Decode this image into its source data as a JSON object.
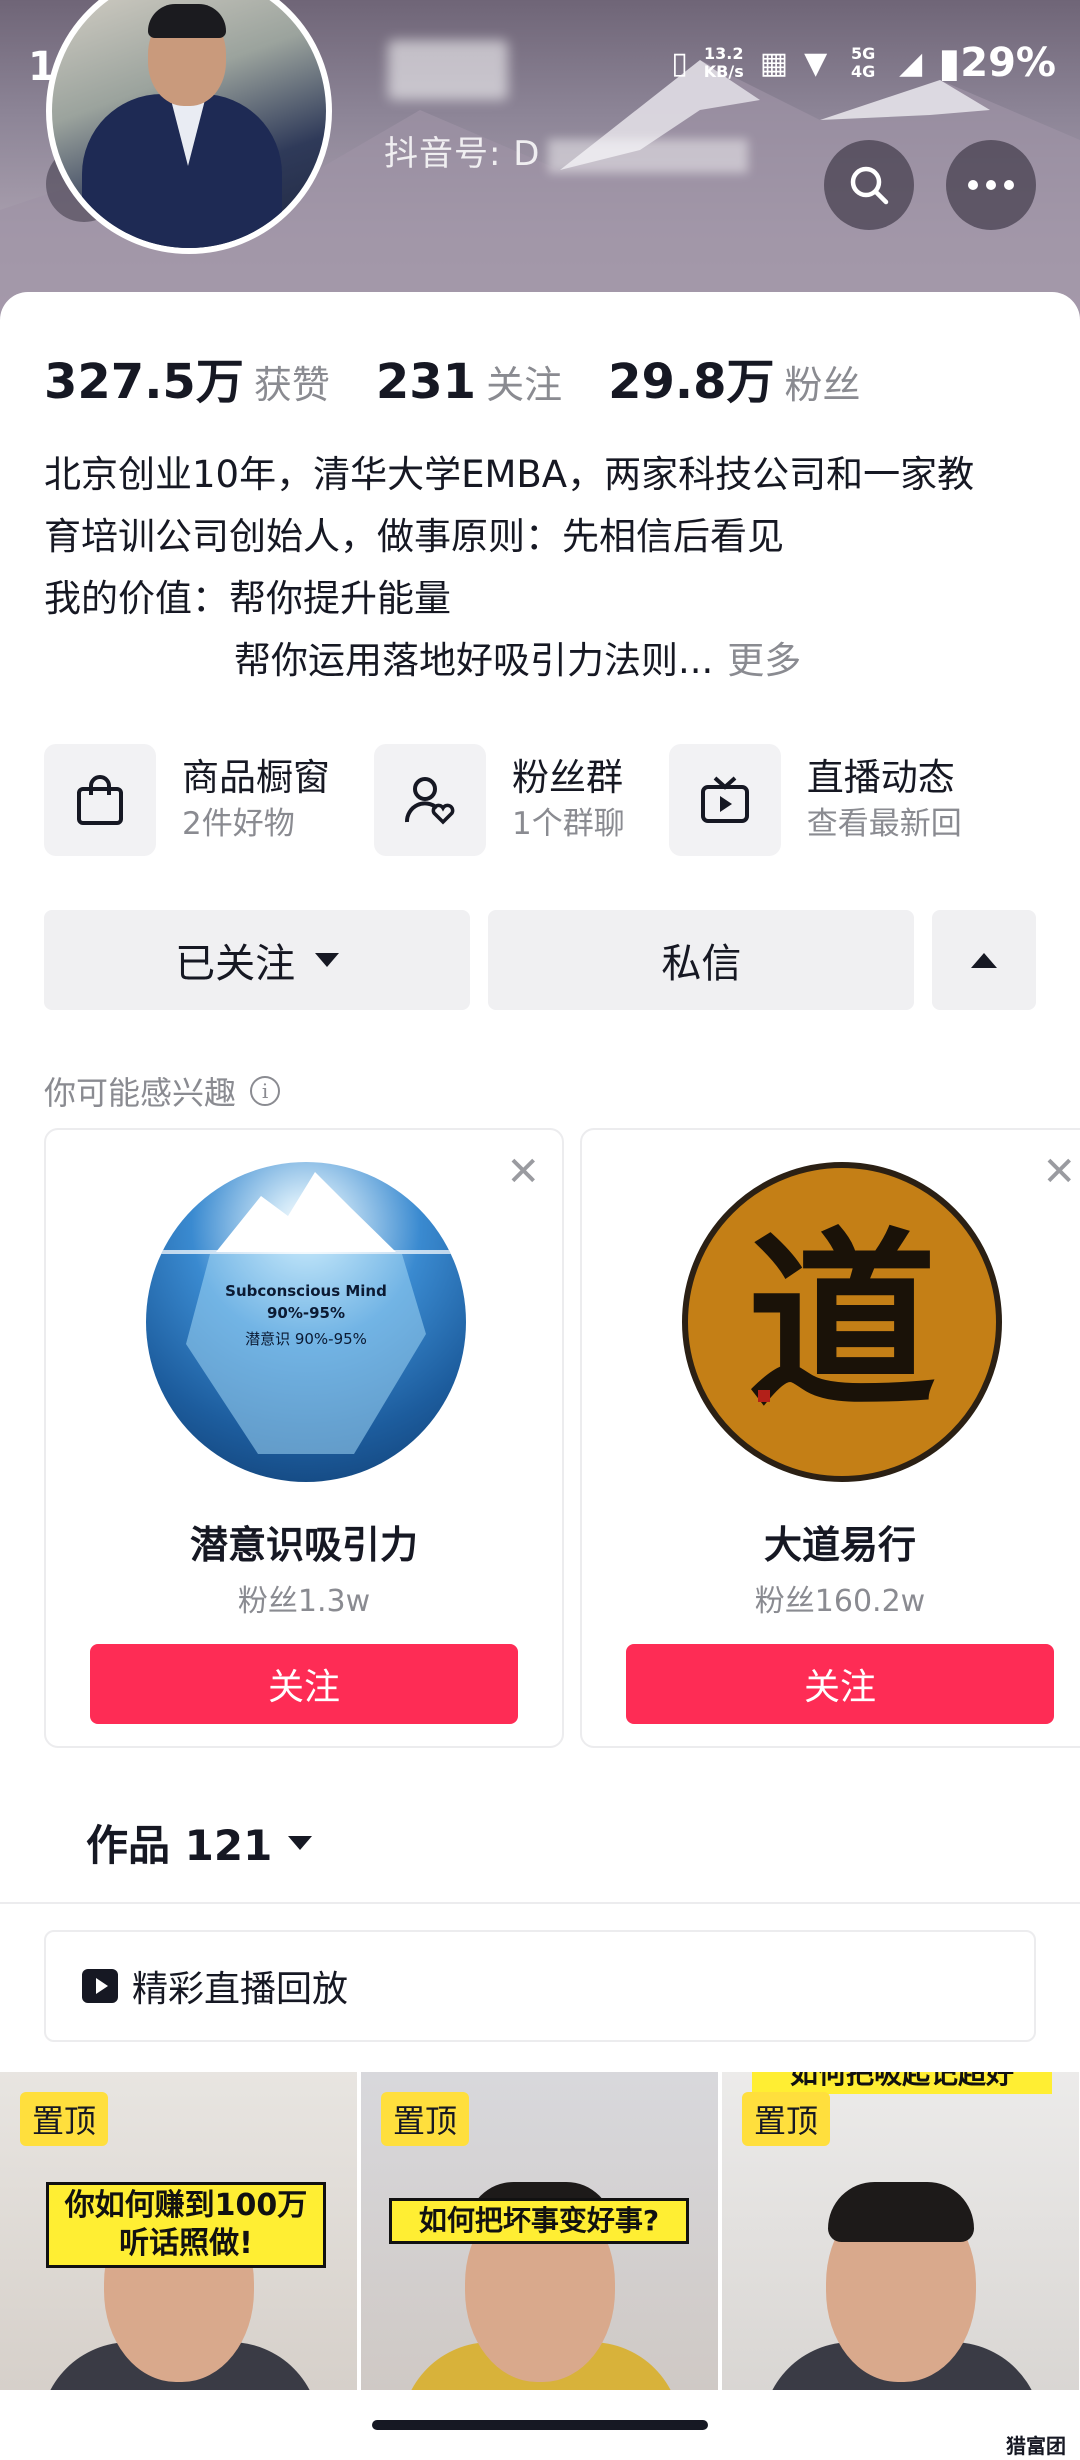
{
  "status_bar": {
    "time": "10:51",
    "net_speed_value": "13.2",
    "net_speed_unit": "KB/s",
    "network": "5G 4G",
    "battery": "29%"
  },
  "profile": {
    "douyin_id_label": "抖音号: D"
  },
  "stats": [
    {
      "value": "327.5万",
      "label": "获赞"
    },
    {
      "value": "231",
      "label": "关注"
    },
    {
      "value": "29.8万",
      "label": "粉丝"
    }
  ],
  "bio": {
    "line1": "北京创业10年，清华大学EMBA，两家科技公司和一家教",
    "line2": "育培训公司创始人，做事原则：先相信后看见",
    "line3": "我的价值：帮你提升能量",
    "line4": "帮你运用落地好吸引力法则...",
    "more": "更多"
  },
  "features": [
    {
      "title": "商品橱窗",
      "sub": "2件好物",
      "icon": "shopping-bag-icon"
    },
    {
      "title": "粉丝群",
      "sub": "1个群聊",
      "icon": "fan-group-icon"
    },
    {
      "title": "直播动态",
      "sub": "查看最新回",
      "icon": "tv-play-icon"
    }
  ],
  "actions": {
    "followed_label": "已关注",
    "message_label": "私信"
  },
  "suggest": {
    "heading": "你可能感兴趣",
    "cards": [
      {
        "name": "潜意识吸引力",
        "fans": "粉丝1.3w",
        "follow": "关注",
        "avatar_text_1": "Subconscious Mind",
        "avatar_text_2": "90%-95%",
        "avatar_text_3": "潜意识 90%-95%"
      },
      {
        "name": "大道易行",
        "fans": "粉丝160.2w",
        "follow": "关注",
        "avatar_char": "道"
      }
    ]
  },
  "works": {
    "tab_label": "作品 121",
    "replay_label": "精彩直播回放"
  },
  "videos": [
    {
      "pin": "置顶",
      "caption_line1": "你如何赚到100万",
      "caption_line2": "听话照做!"
    },
    {
      "pin": "置顶",
      "caption_line1": "如何把坏事变好事?"
    },
    {
      "pin": "置顶",
      "caption_line1": "如何把吸起记超好"
    }
  ],
  "colors": {
    "accent": "#fe2c55",
    "pin_badge": "#ffdf3d",
    "text_primary": "#161823",
    "text_secondary": "#8a8b91"
  },
  "watermark": "猎富团"
}
